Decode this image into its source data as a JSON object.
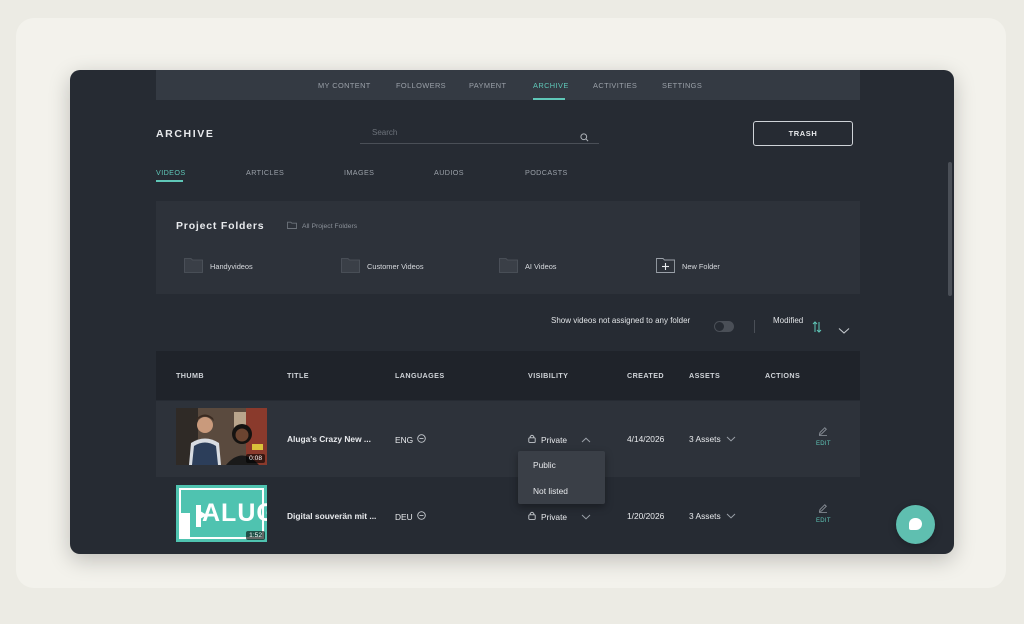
{
  "nav": {
    "tabs": [
      "MY CONTENT",
      "FOLLOWERS",
      "PAYMENT",
      "ARCHIVE",
      "ACTIVITIES",
      "SETTINGS"
    ],
    "active": "ARCHIVE"
  },
  "header": {
    "title": "ARCHIVE",
    "search_placeholder": "Search",
    "trash_label": "TRASH"
  },
  "subtabs": {
    "items": [
      "VIDEOS",
      "ARTICLES",
      "IMAGES",
      "AUDIOS",
      "PODCASTS"
    ],
    "active": "VIDEOS"
  },
  "folders": {
    "heading": "Project Folders",
    "all_label": "All Project Folders",
    "items": [
      "Handyvideos",
      "Customer Videos",
      "AI Videos"
    ],
    "new_label": "New Folder"
  },
  "filter": {
    "unassigned_label": "Show videos not assigned to any folder",
    "unassigned_enabled": false,
    "sort_label": "Modified"
  },
  "table": {
    "columns": [
      "THUMB",
      "TITLE",
      "LANGUAGES",
      "VISIBILITY",
      "CREATED",
      "ASSETS",
      "ACTIONS"
    ],
    "rows": [
      {
        "duration": "0:08",
        "title": "Aluga's Crazy New ...",
        "language": "ENG",
        "visibility": "Private",
        "created": "4/14/2026",
        "assets": "3 Assets",
        "action": "EDIT"
      },
      {
        "duration": "1:52",
        "title": "Digital souverän mit ...",
        "language": "DEU",
        "visibility": "Private",
        "created": "1/20/2026",
        "assets": "3 Assets",
        "action": "EDIT",
        "thumb_text": "ALUG"
      }
    ]
  },
  "visibility_menu": {
    "options": [
      "Public",
      "Not listed"
    ]
  },
  "colors": {
    "accent": "#5fc7b8",
    "window_bg": "#262b33",
    "panel_bg": "#2d323a",
    "header_bg": "#1f232a"
  }
}
